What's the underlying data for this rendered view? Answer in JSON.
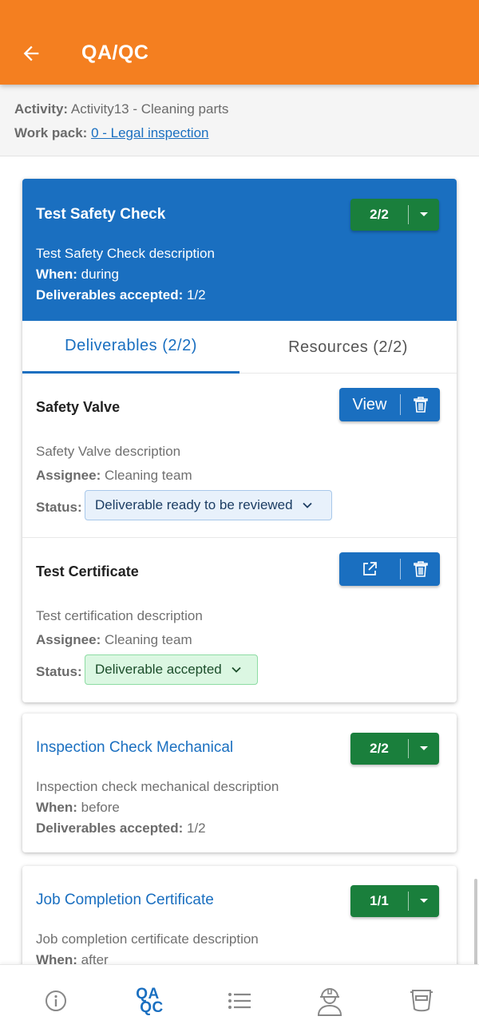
{
  "appbar": {
    "title": "QA/QC",
    "back_icon": "arrow-left-icon",
    "color": "#f47f20"
  },
  "activity": {
    "activity_label": "Activity:",
    "activity_value": "Activity13 - Cleaning parts",
    "workpack_label": "Work pack:",
    "workpack_value": "0 - Legal inspection"
  },
  "checks": [
    {
      "title": "Test Safety Check",
      "description": "Test Safety Check description",
      "when_label": "When:",
      "when_value": "during",
      "accepted_label": "Deliverables accepted:",
      "accepted_value": "1/2",
      "count": "2/2",
      "expanded": true
    },
    {
      "title": "Inspection Check Mechanical",
      "description": "Inspection check mechanical description",
      "when_label": "When:",
      "when_value": "before",
      "accepted_label": "Deliverables accepted:",
      "accepted_value": "1/2",
      "count": "2/2",
      "expanded": false
    },
    {
      "title": "Job Completion Certificate",
      "description": "Job completion certificate description",
      "when_label": "When:",
      "when_value": "after",
      "count": "1/1",
      "expanded": false
    }
  ],
  "tabs": [
    {
      "label": "Deliverables (2/2)",
      "active": true
    },
    {
      "label": "Resources (2/2)",
      "active": false
    }
  ],
  "deliverables": [
    {
      "name": "Safety Valve",
      "description": "Safety Valve description",
      "assignee_label": "Assignee:",
      "assignee_value": "Cleaning team",
      "status_label": "Status:",
      "status_value": "Deliverable ready to be reviewed",
      "action_label": "View",
      "action_icon": "view-text",
      "secondary_icon": "trash-icon"
    },
    {
      "name": "Test Certificate",
      "description": "Test certification description",
      "assignee_label": "Assignee:",
      "assignee_value": "Cleaning team",
      "status_label": "Status:",
      "status_value": "Deliverable accepted",
      "action_icon": "external-link-icon",
      "secondary_icon": "trash-icon"
    }
  ],
  "bottom_nav": {
    "items": [
      {
        "name": "info",
        "icon": "info-icon"
      },
      {
        "name": "qaqc",
        "label_line1": "QA",
        "label_line2": "QC",
        "active": true
      },
      {
        "name": "list",
        "icon": "list-icon"
      },
      {
        "name": "worker",
        "icon": "worker-icon"
      },
      {
        "name": "mask",
        "icon": "welding-mask-icon"
      }
    ]
  },
  "colors": {
    "primary": "#1a6fc0",
    "success": "#1a7f3c",
    "orange": "#f47f20",
    "review_bg": "#e8f1fb",
    "accepted_bg": "#dbf7e2"
  }
}
